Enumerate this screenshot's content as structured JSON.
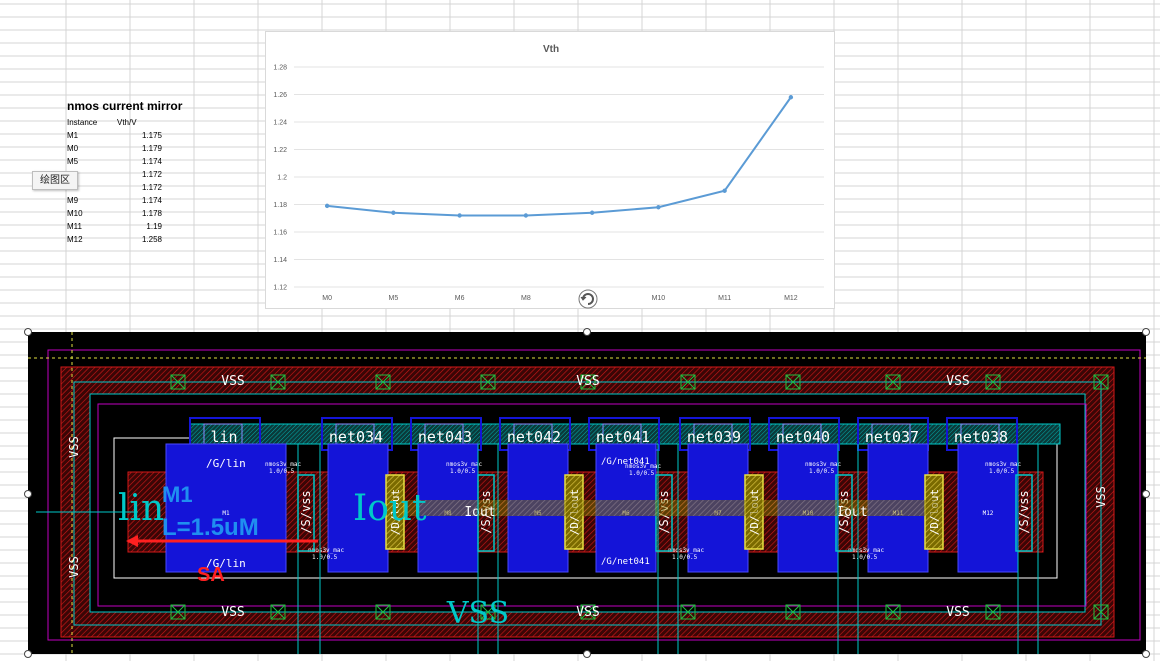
{
  "table": {
    "title": "nmos current mirror",
    "header": [
      "Instance",
      "Vth/V"
    ],
    "rows": [
      [
        "M1",
        "1.175"
      ],
      [
        "M0",
        "1.179"
      ],
      [
        "M5",
        "1.174"
      ],
      [
        "",
        "1.172"
      ],
      [
        "",
        "1.172"
      ],
      [
        "M9",
        "1.174"
      ],
      [
        "M10",
        "1.178"
      ],
      [
        "M11",
        "1.19"
      ],
      [
        "M12",
        "1.258"
      ]
    ]
  },
  "tooltip": {
    "label": "绘图区"
  },
  "chart_data": {
    "type": "line",
    "title": "Vth",
    "categories": [
      "M0",
      "M5",
      "M6",
      "M8",
      "",
      "M10",
      "M11",
      "M12"
    ],
    "series": [
      {
        "values": [
          1.179,
          1.174,
          1.172,
          1.172,
          1.174,
          1.178,
          1.19,
          1.258
        ],
        "color": "#5b9bd5"
      }
    ],
    "yticks": [
      "1.12",
      "1.14",
      "1.16",
      "1.18",
      "1.2",
      "1.22",
      "1.24",
      "1.26",
      "1.28"
    ],
    "ylim": [
      1.12,
      1.28
    ],
    "grid": true
  },
  "layout_image": {
    "colors": {
      "background": "#000000",
      "metal_red": "#d21818",
      "metal_blue": "#1414d8",
      "cyan": "#00c8c8",
      "white": "#ffffff",
      "magenta": "#c000c0",
      "green": "#20c040"
    },
    "net_labels": [
      "lin",
      "net034",
      "net043",
      "net042",
      "net041",
      "net039",
      "net040",
      "net037",
      "net038"
    ],
    "vss_labels": [
      "VSS",
      "VSS",
      "VSS",
      "VSS",
      "VSS",
      "VSS",
      "VSS",
      "VSS",
      "VSS"
    ],
    "big_vss": "VSS",
    "pin_lin": "lin",
    "pin_iout": "Iout",
    "iout_labels": [
      "Iout",
      "Iout"
    ],
    "gate_top_left": "/G/lin",
    "gate_bottom_left": "/G/lin",
    "gate_top_mid": "/G/net041",
    "gate_bottom_mid": "/G/net041",
    "source_labels": [
      "/S/vss",
      "/S/vss",
      "/S/vss",
      "/S/vss",
      "/S/vss"
    ],
    "drain_labels": [
      "/D/lout",
      "/D/lout",
      "/D/lout",
      "/D/lout"
    ],
    "device_labels": [
      "M1",
      "M8",
      "M5",
      "M6",
      "M7",
      "M10",
      "M11",
      "M12"
    ],
    "device_model": "nmos3v_mac",
    "device_size": "1.0/0.5",
    "annotation": {
      "name": "M1",
      "length": "L=1.5uM",
      "note": "SA",
      "name_color": "#1f8ff0",
      "note_color": "#ff2020"
    }
  }
}
